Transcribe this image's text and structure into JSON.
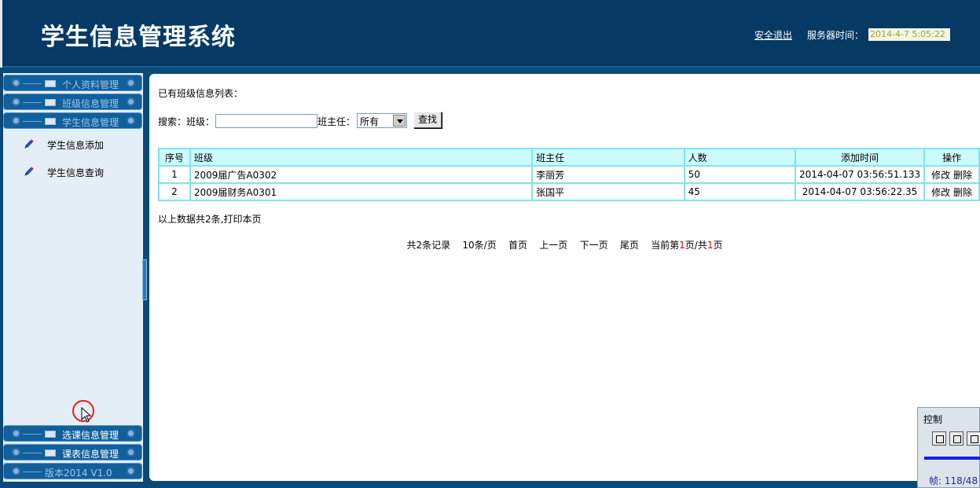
{
  "header": {
    "title": "学生信息管理系统",
    "logout": "安全退出",
    "server_time_label": "服务器时间：",
    "server_time": "2014-4-7 5:05:22"
  },
  "sidebar": {
    "menus": [
      {
        "label": "个人资料管理"
      },
      {
        "label": "班级信息管理"
      },
      {
        "label": "学生信息管理"
      }
    ],
    "sub_items": [
      {
        "label": "学生信息添加"
      },
      {
        "label": "学生信息查询"
      }
    ],
    "bottom_menus": [
      {
        "label": "选课信息管理"
      },
      {
        "label": "课表信息管理"
      }
    ],
    "version": "版本2014 V1.0"
  },
  "main": {
    "list_title": "已有班级信息列表：",
    "search": {
      "label": "搜索：",
      "class_label": "班级：",
      "teacher_label": "班主任：",
      "teacher_selected": "所有",
      "button": "查找"
    },
    "table": {
      "headers": [
        "序号",
        "班级",
        "班主任",
        "人数",
        "添加时间",
        "操作"
      ],
      "rows": [
        [
          "1",
          "2009届广告A0302",
          "李丽芳",
          "50",
          "2014-04-07 03:56:51.133"
        ],
        [
          "2",
          "2009届财务A0301",
          "张国平",
          "45",
          "2014-04-07 03:56:22.35"
        ]
      ],
      "edit_label": "修改",
      "delete_label": "删除"
    },
    "summary": "以上数据共2条,打印本页",
    "pager": {
      "total": "共2条记录",
      "per_page": "10条/页",
      "first": "首页",
      "prev": "上一页",
      "next": "下一页",
      "last": "尾页",
      "current_prefix": "当前第",
      "current": "1",
      "mid": "页/共",
      "pages": "1",
      "suffix": "页"
    }
  },
  "control_panel": {
    "title": "控制",
    "frame": "帧: 118/48"
  }
}
